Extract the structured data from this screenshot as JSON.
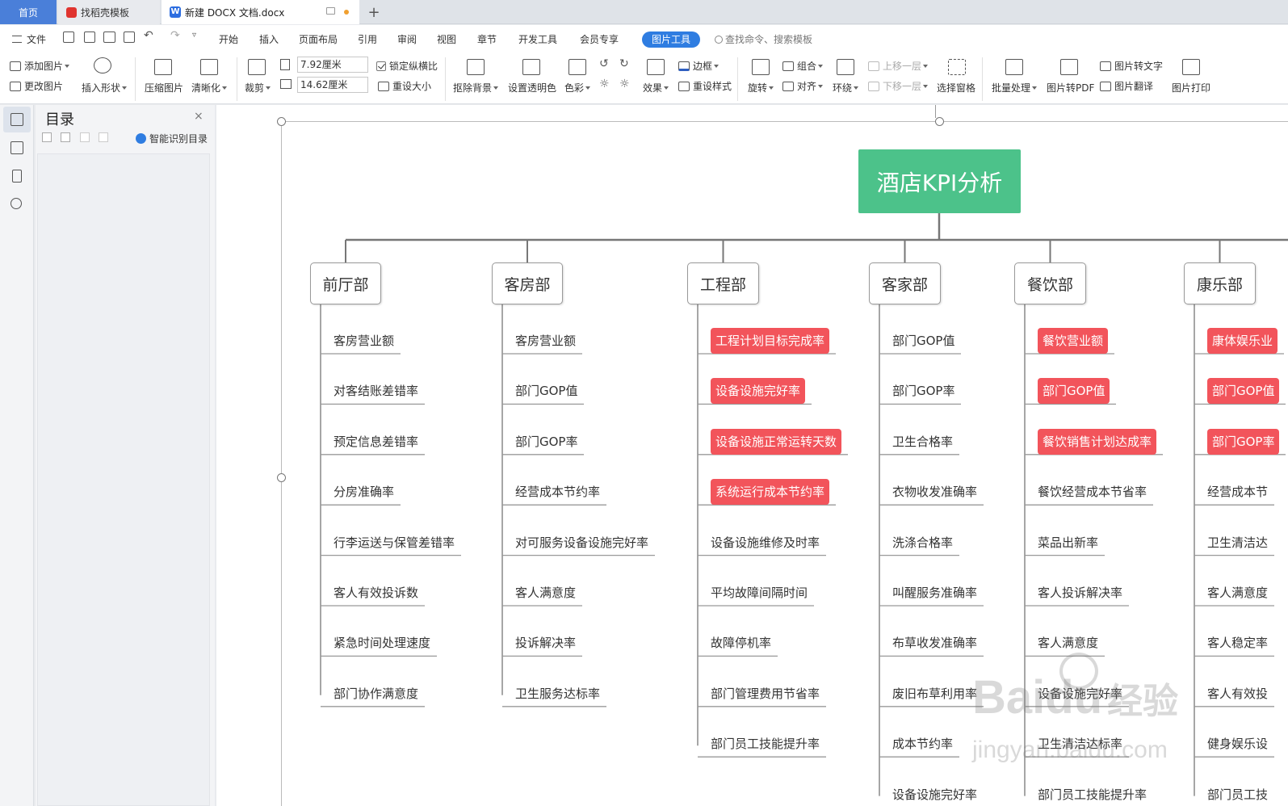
{
  "tabs": {
    "home": "首页",
    "template": "找稻壳模板",
    "doc": "新建 DOCX 文档.docx",
    "add": "+"
  },
  "menu": {
    "file": "文件",
    "items": [
      "开始",
      "插入",
      "页面布局",
      "引用",
      "审阅",
      "视图",
      "章节",
      "开发工具",
      "会员专享"
    ],
    "active": "图片工具",
    "search": "查找命令、搜索模板"
  },
  "ribbon": {
    "add_image": "添加图片",
    "change_image": "更改图片",
    "insert_shape": "插入形状",
    "compress": "压缩图片",
    "sharpen": "清晰化",
    "crop": "裁剪",
    "width": "7.92厘米",
    "height": "14.62厘米",
    "lock_ratio": "锁定纵横比",
    "reset_size": "重设大小",
    "remove_bg": "抠除背景",
    "set_transparent": "设置透明色",
    "color": "色彩",
    "effects": "效果",
    "border": "边框",
    "reset_style": "重设样式",
    "rotate": "旋转",
    "group": "组合",
    "align": "对齐",
    "wrap": "环绕",
    "bring_forward": "上移一层",
    "send_backward": "下移一层",
    "selection_pane": "选择窗格",
    "batch": "批量处理",
    "to_pdf": "图片转PDF",
    "to_text": "图片转文字",
    "translate": "图片翻译",
    "print": "图片打印"
  },
  "toc": {
    "title": "目录",
    "close": "×",
    "smart": "智能识别目录"
  },
  "chart": {
    "root": "酒店KPI分析",
    "departments": [
      {
        "name": "前厅部",
        "items": [
          {
            "t": "客房营业额",
            "h": false
          },
          {
            "t": "对客结账差错率",
            "h": false
          },
          {
            "t": "预定信息差错率",
            "h": false
          },
          {
            "t": "分房准确率",
            "h": false
          },
          {
            "t": "行李运送与保管差错率",
            "h": false
          },
          {
            "t": "客人有效投诉数",
            "h": false
          },
          {
            "t": "紧急时间处理速度",
            "h": false
          },
          {
            "t": "部门协作满意度",
            "h": false
          }
        ]
      },
      {
        "name": "客房部",
        "items": [
          {
            "t": "客房营业额",
            "h": false
          },
          {
            "t": "部门GOP值",
            "h": false
          },
          {
            "t": "部门GOP率",
            "h": false
          },
          {
            "t": "经营成本节约率",
            "h": false
          },
          {
            "t": "对可服务设备设施完好率",
            "h": false
          },
          {
            "t": "客人满意度",
            "h": false
          },
          {
            "t": "投诉解决率",
            "h": false
          },
          {
            "t": "卫生服务达标率",
            "h": false
          }
        ]
      },
      {
        "name": "工程部",
        "items": [
          {
            "t": "工程计划目标完成率",
            "h": true
          },
          {
            "t": "设备设施完好率",
            "h": true
          },
          {
            "t": "设备设施正常运转天数",
            "h": true
          },
          {
            "t": "系统运行成本节约率",
            "h": true
          },
          {
            "t": "设备设施维修及时率",
            "h": false
          },
          {
            "t": "平均故障间隔时间",
            "h": false
          },
          {
            "t": "故障停机率",
            "h": false
          },
          {
            "t": "部门管理费用节省率",
            "h": false
          },
          {
            "t": "部门员工技能提升率",
            "h": false
          }
        ]
      },
      {
        "name": "客家部",
        "items": [
          {
            "t": "部门GOP值",
            "h": false
          },
          {
            "t": "部门GOP率",
            "h": false
          },
          {
            "t": "卫生合格率",
            "h": false
          },
          {
            "t": "衣物收发准确率",
            "h": false
          },
          {
            "t": "洗涤合格率",
            "h": false
          },
          {
            "t": "叫醒服务准确率",
            "h": false
          },
          {
            "t": "布草收发准确率",
            "h": false
          },
          {
            "t": "废旧布草利用率",
            "h": false
          },
          {
            "t": "成本节约率",
            "h": false
          },
          {
            "t": "设备设施完好率",
            "h": false
          }
        ]
      },
      {
        "name": "餐饮部",
        "items": [
          {
            "t": "餐饮营业额",
            "h": true
          },
          {
            "t": "部门GOP值",
            "h": true
          },
          {
            "t": "餐饮销售计划达成率",
            "h": true
          },
          {
            "t": "餐饮经营成本节省率",
            "h": false
          },
          {
            "t": "菜品出新率",
            "h": false
          },
          {
            "t": "客人投诉解决率",
            "h": false
          },
          {
            "t": "客人满意度",
            "h": false
          },
          {
            "t": "设备设施完好率",
            "h": false
          },
          {
            "t": "卫生清洁达标率",
            "h": false
          },
          {
            "t": "部门员工技能提升率",
            "h": false
          }
        ]
      },
      {
        "name": "康乐部",
        "items": [
          {
            "t": "康体娱乐业",
            "h": true
          },
          {
            "t": "部门GOP值",
            "h": true
          },
          {
            "t": "部门GOP率",
            "h": true
          },
          {
            "t": "经营成本节",
            "h": false
          },
          {
            "t": "卫生清洁达",
            "h": false
          },
          {
            "t": "客人满意度",
            "h": false
          },
          {
            "t": "客人稳定率",
            "h": false
          },
          {
            "t": "客人有效投",
            "h": false
          },
          {
            "t": "健身娱乐设",
            "h": false
          },
          {
            "t": "部门员工技",
            "h": false
          }
        ]
      }
    ]
  },
  "watermark": {
    "brand": "Bai",
    "brand2": "du",
    "cn": "经验",
    "url": "jingyan.baidu.com"
  }
}
